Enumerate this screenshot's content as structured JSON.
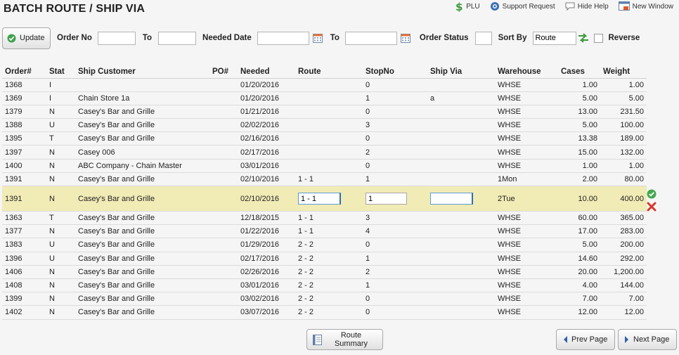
{
  "page": {
    "title": "BATCH ROUTE / SHIP VIA"
  },
  "toplinks": [
    {
      "label": "PLU",
      "icon": "dollar-icon"
    },
    {
      "label": "Support Request",
      "icon": "help-icon"
    },
    {
      "label": "Hide Help",
      "icon": "speech-bubble-icon"
    },
    {
      "label": "New Window",
      "icon": "new-window-icon"
    }
  ],
  "filters": {
    "update_label": "Update",
    "order_no_label": "Order No",
    "to_label": "To",
    "needed_date_label": "Needed Date",
    "order_status_label": "Order Status",
    "sort_by_label": "Sort By",
    "sort_by_value": "Route",
    "reverse_label": "Reverse",
    "reverse_checked": false
  },
  "table": {
    "columns": [
      "Order#",
      "Stat",
      "Ship Customer",
      "PO#",
      "Needed",
      "Route",
      "StopNo",
      "Ship Via",
      "Warehouse",
      "Cases",
      "Weight"
    ],
    "rows": [
      {
        "order": "1368",
        "stat": "I",
        "customer": "",
        "po": "",
        "needed": "01/20/2016",
        "route": "",
        "stop": "0",
        "shipvia": "",
        "warehouse": "WHSE",
        "cases": "1.00",
        "weight": "1.00"
      },
      {
        "order": "1369",
        "stat": "I",
        "customer": "Chain Store 1a",
        "po": "",
        "needed": "01/20/2016",
        "route": "",
        "stop": "1",
        "shipvia": "a",
        "warehouse": "WHSE",
        "cases": "5.00",
        "weight": "5.00"
      },
      {
        "order": "1379",
        "stat": "N",
        "customer": "Casey's Bar and Grille",
        "po": "",
        "needed": "01/21/2016",
        "route": "",
        "stop": "0",
        "shipvia": "",
        "warehouse": "WHSE",
        "cases": "13.00",
        "weight": "231.50"
      },
      {
        "order": "1388",
        "stat": "U",
        "customer": "Casey's Bar and Grille",
        "po": "",
        "needed": "02/02/2016",
        "route": "",
        "stop": "3",
        "shipvia": "",
        "warehouse": "WHSE",
        "cases": "5.00",
        "weight": "100.00"
      },
      {
        "order": "1395",
        "stat": "T",
        "customer": "Casey's Bar and Grille",
        "po": "",
        "needed": "02/16/2016",
        "route": "",
        "stop": "0",
        "shipvia": "",
        "warehouse": "WHSE",
        "cases": "13.38",
        "weight": "189.00"
      },
      {
        "order": "1397",
        "stat": "N",
        "customer": "Casey 006",
        "po": "",
        "needed": "02/17/2016",
        "route": "",
        "stop": "2",
        "shipvia": "",
        "warehouse": "WHSE",
        "cases": "15.00",
        "weight": "132.00"
      },
      {
        "order": "1400",
        "stat": "N",
        "customer": "ABC Company - Chain Master",
        "po": "",
        "needed": "03/01/2016",
        "route": "",
        "stop": "0",
        "shipvia": "",
        "warehouse": "WHSE",
        "cases": "1.00",
        "weight": "1.00"
      },
      {
        "order": "1391",
        "stat": "N",
        "customer": "Casey's Bar and Grille",
        "po": "",
        "needed": "02/10/2016",
        "route": "1 - 1",
        "stop": "1",
        "shipvia": "",
        "warehouse": "1Mon",
        "cases": "2.00",
        "weight": "80.00"
      }
    ],
    "edit_row": {
      "order": "1391",
      "stat": "N",
      "customer": "Casey's Bar and Grille",
      "po": "",
      "needed": "02/10/2016",
      "route": "1 - 1",
      "stop": "1",
      "shipvia": "",
      "warehouse": "2Tue",
      "cases": "10.00",
      "weight": "400.00"
    },
    "rows_after": [
      {
        "order": "1363",
        "stat": "T",
        "customer": "Casey's Bar and Grille",
        "po": "",
        "needed": "12/18/2015",
        "route": "1 - 1",
        "stop": "3",
        "shipvia": "",
        "warehouse": "WHSE",
        "cases": "60.00",
        "weight": "365.00"
      },
      {
        "order": "1377",
        "stat": "N",
        "customer": "Casey's Bar and Grille",
        "po": "",
        "needed": "01/22/2016",
        "route": "1 - 1",
        "stop": "4",
        "shipvia": "",
        "warehouse": "WHSE",
        "cases": "17.00",
        "weight": "283.00"
      },
      {
        "order": "1383",
        "stat": "U",
        "customer": "Casey's Bar and Grille",
        "po": "",
        "needed": "01/29/2016",
        "route": "2 - 2",
        "stop": "0",
        "shipvia": "",
        "warehouse": "WHSE",
        "cases": "5.00",
        "weight": "200.00"
      },
      {
        "order": "1396",
        "stat": "U",
        "customer": "Casey's Bar and Grille",
        "po": "",
        "needed": "02/17/2016",
        "route": "2 - 2",
        "stop": "1",
        "shipvia": "",
        "warehouse": "WHSE",
        "cases": "14.60",
        "weight": "292.00"
      },
      {
        "order": "1406",
        "stat": "N",
        "customer": "Casey's Bar and Grille",
        "po": "",
        "needed": "02/26/2016",
        "route": "2 - 2",
        "stop": "2",
        "shipvia": "",
        "warehouse": "WHSE",
        "cases": "20.00",
        "weight": "1,200.00"
      },
      {
        "order": "1408",
        "stat": "N",
        "customer": "Casey's Bar and Grille",
        "po": "",
        "needed": "03/01/2016",
        "route": "2 - 2",
        "stop": "1",
        "shipvia": "",
        "warehouse": "WHSE",
        "cases": "4.00",
        "weight": "144.00"
      },
      {
        "order": "1399",
        "stat": "N",
        "customer": "Casey's Bar and Grille",
        "po": "",
        "needed": "03/02/2016",
        "route": "2 - 2",
        "stop": "0",
        "shipvia": "",
        "warehouse": "WHSE",
        "cases": "7.00",
        "weight": "7.00"
      },
      {
        "order": "1402",
        "stat": "N",
        "customer": "Casey's Bar and Grille",
        "po": "",
        "needed": "03/07/2016",
        "route": "2 - 2",
        "stop": "0",
        "shipvia": "",
        "warehouse": "WHSE",
        "cases": "12.00",
        "weight": "12.00"
      }
    ]
  },
  "footer": {
    "route_summary_label": "Route Summary",
    "prev_label": "Prev Page",
    "next_label": "Next Page"
  }
}
